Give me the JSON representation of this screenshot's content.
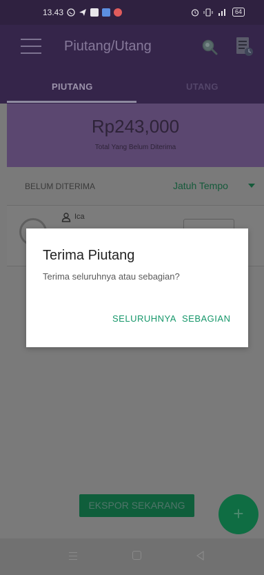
{
  "status_bar": {
    "time": "13.43",
    "battery": "64",
    "icons": [
      "whatsapp-icon",
      "telegram-icon",
      "shopping-bag-icon",
      "message-icon",
      "notification-icon",
      "alarm-icon",
      "vibrate-icon",
      "signal-icon",
      "battery-icon"
    ]
  },
  "appbar": {
    "title": "Piutang/Utang",
    "icons": [
      "menu-icon",
      "search-icon",
      "report-icon"
    ]
  },
  "tabs": [
    {
      "label": "PIUTANG",
      "active": true
    },
    {
      "label": "UTANG",
      "active": false
    }
  ],
  "summary": {
    "amount": "Rp243,000",
    "label": "Total Yang Belum Diterima"
  },
  "filter": {
    "status": "BELUM DITERIMA",
    "sort": "Jatuh Tempo"
  },
  "list": [
    {
      "name": "Ica"
    }
  ],
  "dialog": {
    "title": "Terima Piutang",
    "message": "Terima seluruhnya atau sebagian?",
    "button_all": "SELURUHNYA",
    "button_partial": "SEBAGIAN"
  },
  "export_label": "EKSPOR SEKARANG",
  "fab_label": "+",
  "colors": {
    "primary": "#35254a",
    "accent": "#16976a",
    "overlay": "#7a7a7a"
  }
}
